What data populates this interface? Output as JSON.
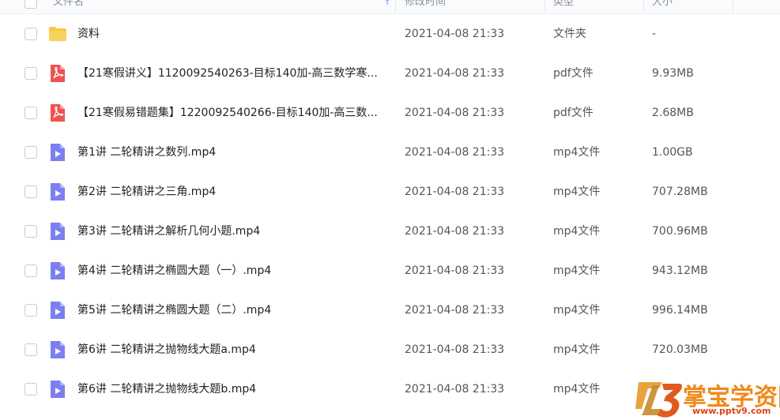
{
  "header": {
    "name": "文件名",
    "modified": "修改时间",
    "type": "类型",
    "size": "大小"
  },
  "files": [
    {
      "icon": "folder-icon",
      "name": "资料",
      "date": "2021-04-08 21:33",
      "type": "文件夹",
      "size": "-"
    },
    {
      "icon": "pdf-icon",
      "name": "【21寒假讲义】1120092540263-目标140加-高三数学寒...",
      "date": "2021-04-08 21:33",
      "type": "pdf文件",
      "size": "9.93MB"
    },
    {
      "icon": "pdf-icon",
      "name": "【21寒假易错题集】1220092540266-目标140加-高三数...",
      "date": "2021-04-08 21:33",
      "type": "pdf文件",
      "size": "2.68MB"
    },
    {
      "icon": "video-icon",
      "name": "第1讲 二轮精讲之数列.mp4",
      "date": "2021-04-08 21:33",
      "type": "mp4文件",
      "size": "1.00GB"
    },
    {
      "icon": "video-icon",
      "name": "第2讲 二轮精讲之三角.mp4",
      "date": "2021-04-08 21:33",
      "type": "mp4文件",
      "size": "707.28MB"
    },
    {
      "icon": "video-icon",
      "name": "第3讲 二轮精讲之解析几何小题.mp4",
      "date": "2021-04-08 21:33",
      "type": "mp4文件",
      "size": "700.96MB"
    },
    {
      "icon": "video-icon",
      "name": "第4讲 二轮精讲之椭圆大题（一）.mp4",
      "date": "2021-04-08 21:33",
      "type": "mp4文件",
      "size": "943.12MB"
    },
    {
      "icon": "video-icon",
      "name": "第5讲 二轮精讲之椭圆大题（二）.mp4",
      "date": "2021-04-08 21:33",
      "type": "mp4文件",
      "size": "996.14MB"
    },
    {
      "icon": "video-icon",
      "name": "第6讲 二轮精讲之抛物线大题a.mp4",
      "date": "2021-04-08 21:33",
      "type": "mp4文件",
      "size": "720.03MB"
    },
    {
      "icon": "video-icon",
      "name": "第6讲 二轮精讲之抛物线大题b.mp4",
      "date": "2021-04-08 21:33",
      "type": "mp4文件",
      "size": ""
    }
  ],
  "watermark": {
    "title": "掌宝学资网",
    "url": "www.pptv9.com"
  },
  "colors": {
    "folder": "#f7c744",
    "pdf": "#ef5350",
    "video": "#7b7ff0",
    "sort_accent": "#4b8df8"
  }
}
